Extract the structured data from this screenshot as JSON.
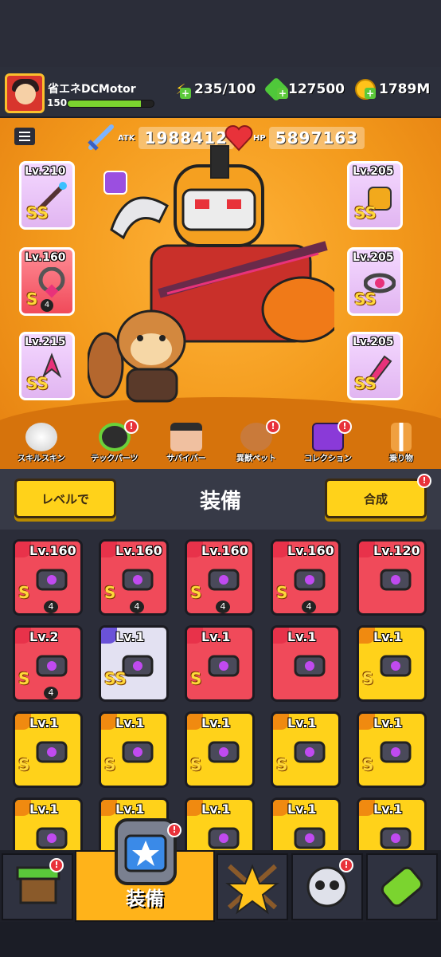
{
  "header": {
    "player_name": "省エネDCMotor",
    "level": "150",
    "xp_fraction": 0.85,
    "energy": "235/100",
    "gems": "127500",
    "coins": "1789M"
  },
  "stats": {
    "atk_label": "ATK",
    "atk_value": "1988412",
    "hp_label": "HP",
    "hp_value": "5897163"
  },
  "equipped_left": [
    {
      "lv": "Lv.210",
      "rank": "SS"
    },
    {
      "lv": "Lv.160",
      "rank": "S",
      "stars": "4"
    },
    {
      "lv": "Lv.215",
      "rank": "SS"
    }
  ],
  "equipped_right": [
    {
      "lv": "Lv.205",
      "rank": "SS"
    },
    {
      "lv": "Lv.205",
      "rank": "SS"
    },
    {
      "lv": "Lv.205",
      "rank": "SS"
    }
  ],
  "features": [
    {
      "label": "スキルスキン"
    },
    {
      "label": "テックパーツ"
    },
    {
      "label": "サバイバー"
    },
    {
      "label": "異獣ペット"
    },
    {
      "label": "コレクション"
    },
    {
      "label": "乗り物"
    }
  ],
  "controls": {
    "sort_label": "レベルで",
    "title": "装備",
    "merge_label": "合成"
  },
  "inventory": [
    {
      "lv": "Lv.160",
      "rank": "S",
      "stars": "4",
      "card": "red-card"
    },
    {
      "lv": "Lv.160",
      "rank": "S",
      "stars": "4",
      "card": "red-card"
    },
    {
      "lv": "Lv.160",
      "rank": "S",
      "stars": "4",
      "card": "red-card"
    },
    {
      "lv": "Lv.160",
      "rank": "S",
      "stars": "4",
      "card": "red-card"
    },
    {
      "lv": "Lv.120",
      "rank": "",
      "stars": "",
      "card": "red-card"
    },
    {
      "lv": "Lv.2",
      "rank": "S",
      "stars": "4",
      "card": "red-card"
    },
    {
      "lv": "Lv.1",
      "rank": "SS",
      "stars": "",
      "card": "white-card"
    },
    {
      "lv": "Lv.1",
      "rank": "S",
      "stars": "",
      "card": "red-card"
    },
    {
      "lv": "Lv.1",
      "rank": "",
      "stars": "",
      "card": "red-card"
    },
    {
      "lv": "Lv.1",
      "rank": "S",
      "stars": "",
      "card": "yellow-card"
    },
    {
      "lv": "Lv.1",
      "rank": "S",
      "stars": "",
      "card": "yellow-card"
    },
    {
      "lv": "Lv.1",
      "rank": "S",
      "stars": "",
      "card": "yellow-card"
    },
    {
      "lv": "Lv.1",
      "rank": "S",
      "stars": "",
      "card": "yellow-card"
    },
    {
      "lv": "Lv.1",
      "rank": "S",
      "stars": "",
      "card": "yellow-card"
    },
    {
      "lv": "Lv.1",
      "rank": "S",
      "stars": "",
      "card": "yellow-card"
    },
    {
      "lv": "Lv.1",
      "rank": "",
      "stars": "",
      "card": "yellow-card"
    },
    {
      "lv": "Lv.1",
      "rank": "",
      "stars": "",
      "card": "yellow-card"
    },
    {
      "lv": "Lv.1",
      "rank": "",
      "stars": "",
      "card": "yellow-card"
    },
    {
      "lv": "Lv.1",
      "rank": "",
      "stars": "",
      "card": "yellow-card"
    },
    {
      "lv": "Lv.1",
      "rank": "",
      "stars": "",
      "card": "yellow-card"
    }
  ],
  "bottom_nav": {
    "equip_label": "装備"
  },
  "colors": {
    "accent": "#ffd21a",
    "stage": "#f39a1c",
    "badge": "#e8323a"
  }
}
